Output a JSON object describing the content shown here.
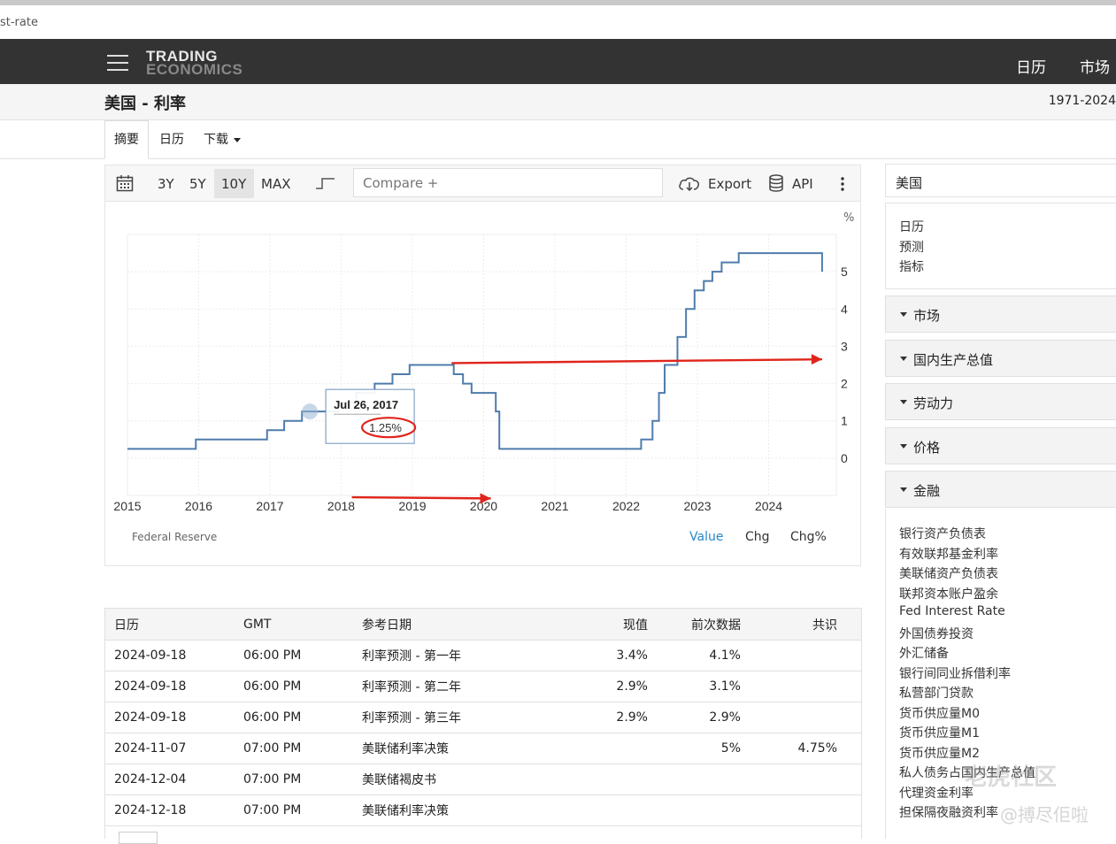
{
  "browser": {
    "url_fragment": "st-rate"
  },
  "header": {
    "logo_line1": "TRADING",
    "logo_line2": "ECONOMICS",
    "nav": [
      "日历",
      "市场"
    ]
  },
  "page": {
    "title": "美国 - 利率",
    "date_range": "1971-2024"
  },
  "tabs": [
    {
      "label": "摘要",
      "active": true
    },
    {
      "label": "日历"
    },
    {
      "label": "下载"
    }
  ],
  "toolbar": {
    "ranges": [
      "3Y",
      "5Y",
      "10Y",
      "MAX"
    ],
    "selected_range": "10Y",
    "compare_placeholder": "Compare +",
    "export_label": "Export",
    "api_label": "API"
  },
  "chart": {
    "source": "Federal Reserve",
    "legend": [
      "Value",
      "Chg",
      "Chg%"
    ],
    "legend_active": "Value",
    "accent": "#2a87c8",
    "line_color": "#4f7cac",
    "annotation_color": "#e0241b"
  },
  "chart_data": {
    "type": "line",
    "step": true,
    "title": "",
    "xlabel": "",
    "ylabel": "%",
    "xlim": [
      2015,
      2024.95
    ],
    "ylim": [
      -1.0,
      6.0
    ],
    "x_ticks": [
      2015,
      2016,
      2017,
      2018,
      2019,
      2020,
      2021,
      2022,
      2023,
      2024
    ],
    "y_ticks": [
      0,
      1,
      2,
      3,
      4,
      5
    ],
    "series": [
      {
        "x": [
          2015.0,
          2015.96,
          2016.96,
          2017.2,
          2017.45,
          2017.96,
          2018.21,
          2018.47,
          2018.72,
          2018.96,
          2019.58,
          2019.71,
          2019.83,
          2020.17,
          2020.22,
          2022.21,
          2022.37,
          2022.46,
          2022.54,
          2022.72,
          2022.84,
          2022.96,
          2023.09,
          2023.21,
          2023.34,
          2023.58,
          2024.71,
          2024.75
        ],
        "values": [
          0.25,
          0.5,
          0.75,
          1.0,
          1.25,
          1.5,
          1.75,
          2.0,
          2.25,
          2.5,
          2.25,
          2.0,
          1.75,
          1.25,
          0.25,
          0.5,
          1.0,
          1.75,
          2.5,
          3.25,
          4.0,
          4.5,
          4.75,
          5.0,
          5.25,
          5.5,
          5.5,
          5.0
        ]
      }
    ],
    "tooltip": {
      "date": "Jul 26, 2017",
      "value_label": "1.25%",
      "x": 2017.56,
      "value": 1.25
    }
  },
  "sidebar": {
    "country": "美国",
    "links": [
      "日历",
      "预测",
      "指标"
    ],
    "sections": [
      "市场",
      "国内生产总值",
      "劳动力",
      "价格",
      "金融"
    ],
    "finance_items": [
      "银行资产负债表",
      "有效联邦基金利率",
      "美联储资产负债表",
      "联邦资本账户盈余",
      "Fed Interest Rate",
      "外国债券投资",
      "外汇储备",
      "银行间同业拆借利率",
      "私营部门贷款",
      "货币供应量M0",
      "货币供应量M1",
      "货币供应量M2",
      "私人债务占国内生产总值",
      "代理资金利率",
      "担保隔夜融资利率"
    ]
  },
  "calendar": {
    "headers": [
      "日历",
      "GMT",
      "参考日期",
      "现值",
      "前次数据",
      "共识"
    ],
    "rows": [
      [
        "2024-09-18",
        "06:00 PM",
        "利率预测 - 第一年",
        "3.4%",
        "4.1%",
        ""
      ],
      [
        "2024-09-18",
        "06:00 PM",
        "利率预测 - 第二年",
        "2.9%",
        "3.1%",
        ""
      ],
      [
        "2024-09-18",
        "06:00 PM",
        "利率预测 - 第三年",
        "2.9%",
        "2.9%",
        ""
      ],
      [
        "2024-11-07",
        "07:00 PM",
        "美联储利率决策",
        "",
        "5%",
        "4.75%"
      ],
      [
        "2024-12-04",
        "07:00 PM",
        "美联储褐皮书",
        "",
        "",
        ""
      ],
      [
        "2024-12-18",
        "07:00 PM",
        "美联储利率决策",
        "",
        "",
        ""
      ]
    ]
  },
  "watermark": {
    "line1": "老虎社区",
    "line2": "@搏尽佢啦"
  }
}
